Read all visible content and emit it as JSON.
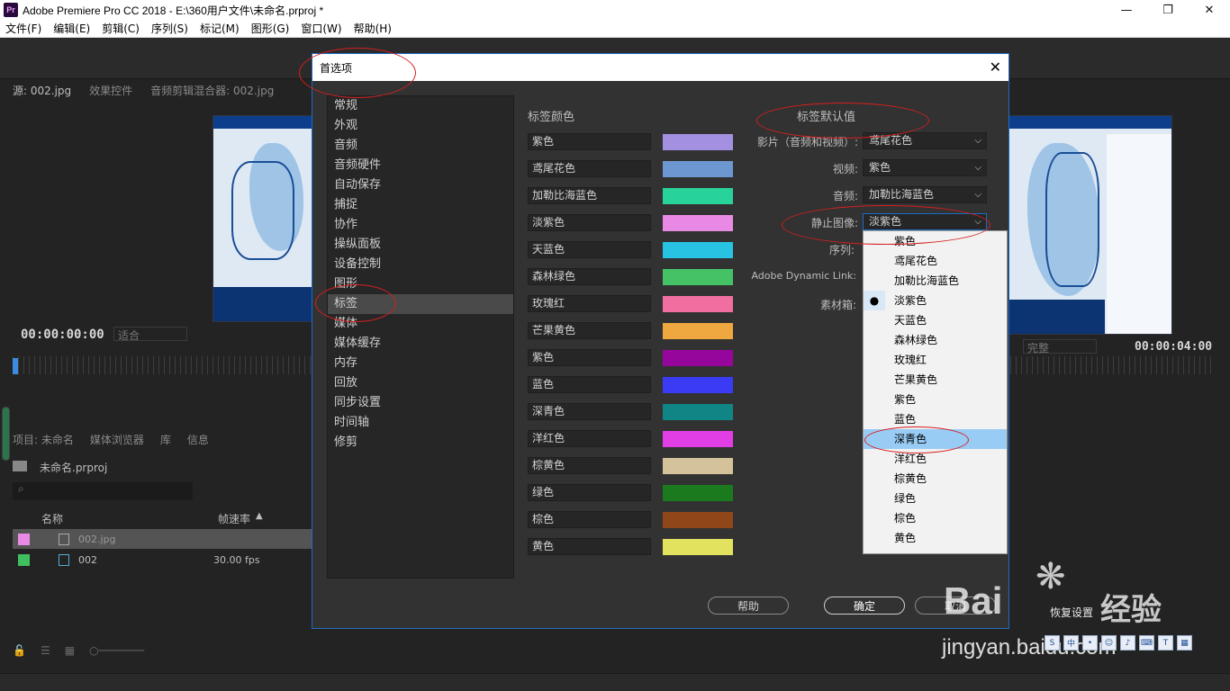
{
  "window": {
    "title": "Adobe Premiere Pro CC 2018 - E:\\360用户文件\\未命名.prproj *",
    "app_icon": "Pr",
    "minimize": "—",
    "maximize": "❐",
    "close": "✕"
  },
  "menubar": [
    "文件(F)",
    "编辑(E)",
    "剪辑(C)",
    "序列(S)",
    "标记(M)",
    "图形(G)",
    "窗口(W)",
    "帮助(H)"
  ],
  "source_panel": {
    "tabs": [
      "源: 002.jpg",
      "效果控件",
      "音频剪辑混合器: 002.jpg"
    ],
    "timecode": "00:00:00:00",
    "fit": "适合"
  },
  "program_panel": {
    "timecode": "00:00:04:00",
    "quality": "完整"
  },
  "project_panel": {
    "tabs": [
      "项目: 未命名",
      "媒体浏览器",
      "库",
      "信息"
    ],
    "project_file": "未命名.prproj",
    "col_name": "名称",
    "col_rate": "帧速率",
    "rows": [
      {
        "name": "002.jpg",
        "rate": "",
        "color": "#e88ae5"
      },
      {
        "name": "002",
        "rate": "30.00 fps",
        "color": "#3fbf5f"
      }
    ]
  },
  "dialog": {
    "title": "首选项",
    "close": "✕",
    "nav": [
      "常规",
      "外观",
      "音频",
      "音频硬件",
      "自动保存",
      "捕捉",
      "协作",
      "操纵面板",
      "设备控制",
      "图形",
      "标签",
      "媒体",
      "媒体缓存",
      "内存",
      "回放",
      "同步设置",
      "时间轴",
      "修剪"
    ],
    "nav_selected": "标签",
    "label_colors_title": "标签颜色",
    "label_colors": [
      {
        "name": "紫色",
        "color": "#a390e0"
      },
      {
        "name": "鸢尾花色",
        "color": "#6d97d0"
      },
      {
        "name": "加勒比海蓝色",
        "color": "#27d39a"
      },
      {
        "name": "淡紫色",
        "color": "#e88ae5"
      },
      {
        "name": "天蓝色",
        "color": "#28c2e3"
      },
      {
        "name": "森林绿色",
        "color": "#45c266"
      },
      {
        "name": "玫瑰红",
        "color": "#f06ea0"
      },
      {
        "name": "芒果黄色",
        "color": "#efa840"
      },
      {
        "name": "紫色",
        "color": "#96059c"
      },
      {
        "name": "蓝色",
        "color": "#3b3bf5"
      },
      {
        "name": "深青色",
        "color": "#0f8585"
      },
      {
        "name": "洋红色",
        "color": "#e23ee6"
      },
      {
        "name": "棕黄色",
        "color": "#d4c29b"
      },
      {
        "name": "绿色",
        "color": "#1c7a1e"
      },
      {
        "name": "棕色",
        "color": "#8f4719"
      },
      {
        "name": "黄色",
        "color": "#e3e25e"
      }
    ],
    "defaults_title": "标签默认值",
    "defaults": [
      {
        "label": "影片（音频和视频）:",
        "value": "鸢尾花色"
      },
      {
        "label": "视频:",
        "value": "紫色"
      },
      {
        "label": "音频:",
        "value": "加勒比海蓝色"
      },
      {
        "label": "静止图像:",
        "value": "淡紫色"
      },
      {
        "label": "序列:",
        "value": ""
      },
      {
        "label": "Adobe Dynamic Link:",
        "value": ""
      },
      {
        "label": "素材箱:",
        "value": ""
      }
    ],
    "dropdown": {
      "items": [
        "紫色",
        "鸢尾花色",
        "加勒比海蓝色",
        "淡紫色",
        "天蓝色",
        "森林绿色",
        "玫瑰红",
        "芒果黄色",
        "紫色",
        "蓝色",
        "深青色",
        "洋红色",
        "棕黄色",
        "绿色",
        "棕色",
        "黄色"
      ],
      "checked": "淡紫色",
      "highlighted": "深青色",
      "check_mark": "●"
    },
    "buttons": {
      "help": "帮助",
      "ok": "确定",
      "cancel": "取消"
    },
    "chevron": "⌵"
  },
  "watermark": {
    "brand": "Bai",
    "brand_cn": "经验",
    "url": "jingyan.baidu.com",
    "reset_text": "恢复设置"
  },
  "colors": {
    "accent": "#1e6bc4",
    "annotation": "#d61f1f",
    "dropdown_highlight": "#99ccf5"
  }
}
